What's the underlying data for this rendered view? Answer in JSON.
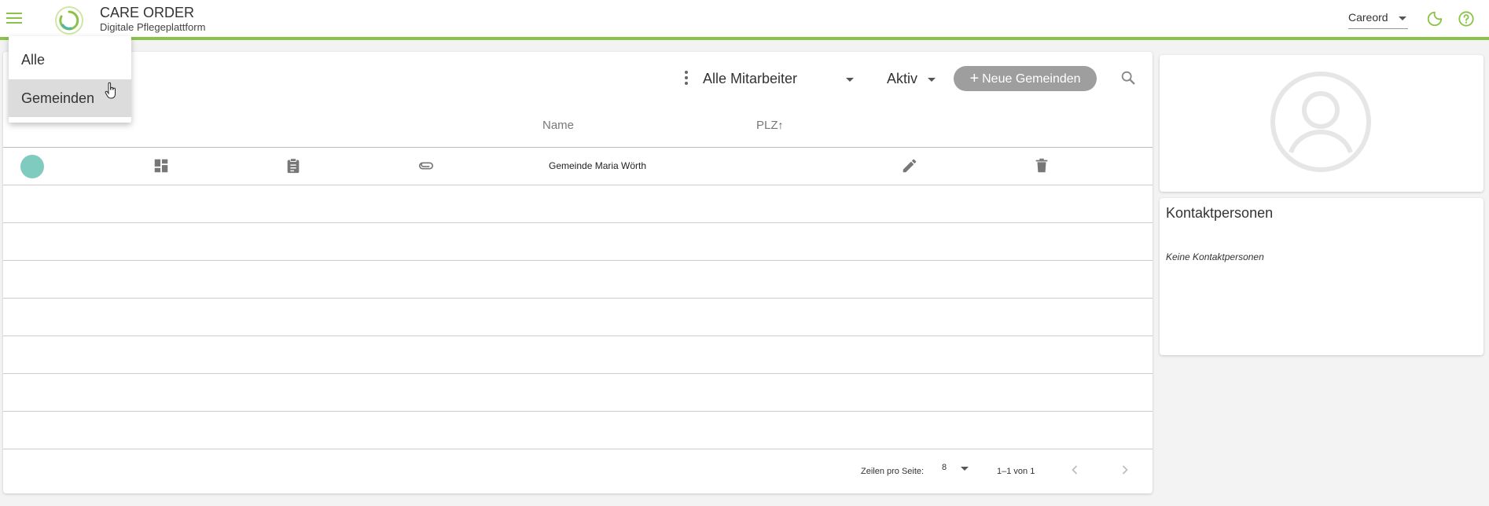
{
  "header": {
    "title": "CARE ORDER",
    "subtitle": "Digitale Pflegeplattform",
    "tenant": "Careord",
    "accent_color": "#8bc34a",
    "icons": [
      "menu-icon",
      "dark-mode-icon",
      "help-icon"
    ]
  },
  "menu": {
    "items": [
      {
        "label": "Alle",
        "selected": false
      },
      {
        "label": "Gemeinden",
        "selected": true
      }
    ]
  },
  "toolbar": {
    "employee_filter": "Alle Mitarbeiter",
    "status_filter": "Aktiv",
    "new_button": "Neue Gemeinden",
    "button_color": "#9e9e9e"
  },
  "table": {
    "columns": {
      "name": "Name",
      "plz": "PLZ"
    },
    "sort_column": "PLZ",
    "sort_direction": "ascending",
    "rows": [
      {
        "status_color": "#7fcbc0",
        "name": "Gemeinde Maria Wörth",
        "plz": ""
      }
    ],
    "row_icons": [
      "dashboard-icon",
      "clipboard-icon",
      "attachment-icon",
      "edit-icon",
      "delete-icon"
    ]
  },
  "pagination": {
    "rows_per_page_label": "Zeilen pro Seite:",
    "rows_per_page": "8",
    "range": "1–1 von 1"
  },
  "contacts": {
    "title": "Kontaktpersonen",
    "empty_text": "Keine Kontaktpersonen"
  }
}
